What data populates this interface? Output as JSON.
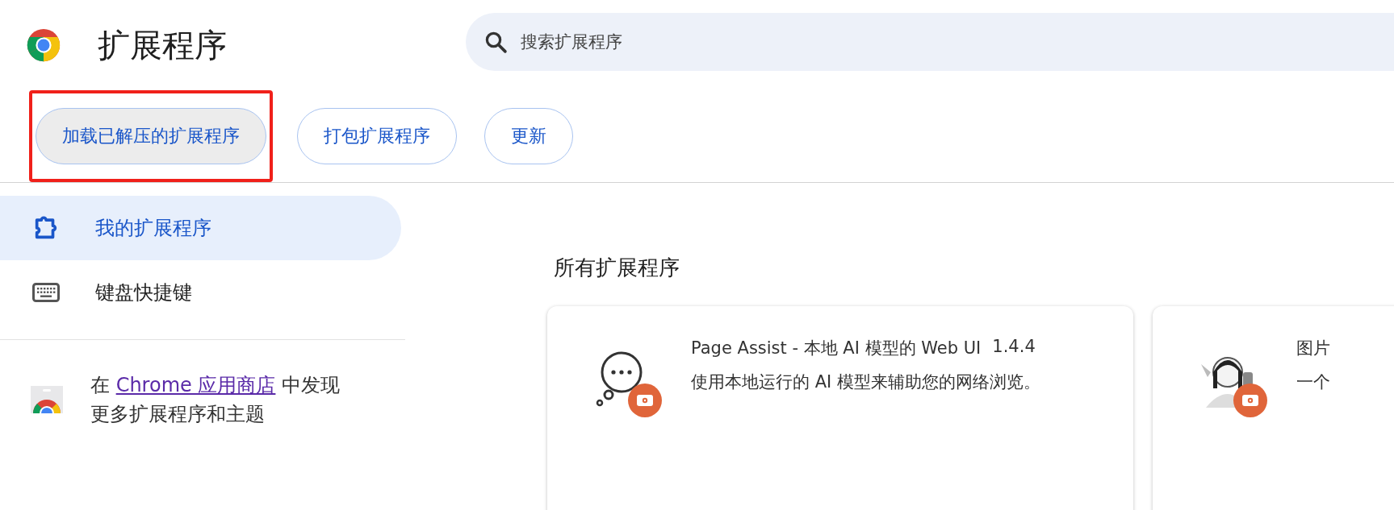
{
  "header": {
    "title": "扩展程序",
    "search": {
      "placeholder": "搜索扩展程序"
    }
  },
  "toolbar": {
    "buttons": [
      {
        "label": "加载已解压的扩展程序",
        "highlighted": true
      },
      {
        "label": "打包扩展程序",
        "highlighted": false
      },
      {
        "label": "更新",
        "highlighted": false
      }
    ]
  },
  "sidebar": {
    "items": [
      {
        "label": "我的扩展程序",
        "selected": true
      },
      {
        "label": "键盘快捷键",
        "selected": false
      }
    ],
    "store_note": {
      "before": "在",
      "link": "Chrome 应用商店",
      "after": "中发现更多扩展程序和主题"
    }
  },
  "main": {
    "section_title": "所有扩展程序",
    "cards": [
      {
        "name": "Page Assist - 本地 AI 模型的 Web UI",
        "version": "1.4.4",
        "description": "使用本地运行的 AI 模型来辅助您的网络浏览。"
      },
      {
        "name": "图片",
        "description": "一个"
      }
    ]
  }
}
